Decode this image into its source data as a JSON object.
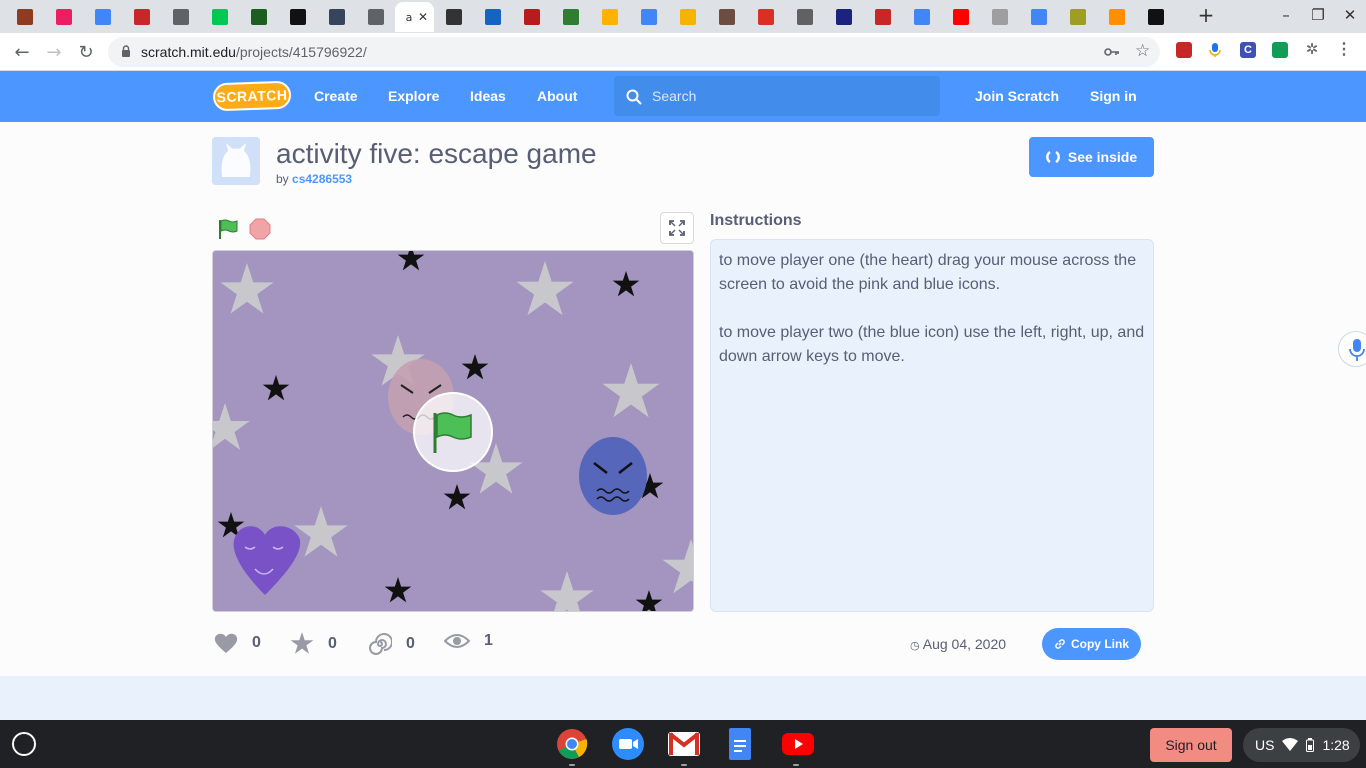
{
  "browser": {
    "tabs": [
      {
        "icon": "fire-icon",
        "color": "#8e3b20"
      },
      {
        "icon": "contact-card-icon",
        "color": "#e91e63"
      },
      {
        "icon": "docs-icon",
        "color": "#4285f4"
      },
      {
        "icon": "pelican-icon",
        "color": "#c62828"
      },
      {
        "icon": "classroom-doc-icon",
        "color": "#5f6368"
      },
      {
        "icon": "hexagon-icon",
        "color": "#00c853"
      },
      {
        "icon": "grid-app-icon",
        "color": "#1b5e20"
      },
      {
        "icon": "qr-grid-icon",
        "color": "#111111"
      },
      {
        "icon": "tumblr-icon",
        "color": "#35465c"
      },
      {
        "icon": "spiral-icon",
        "color": "#5f6368"
      },
      {
        "icon": "scratch-icon",
        "color": "#ffab19",
        "active": true
      },
      {
        "icon": "shield-icon",
        "color": "#333333"
      },
      {
        "icon": "bracket-k-icon",
        "color": "#1565c0"
      },
      {
        "icon": "wa-icon",
        "color": "#b71c1c"
      },
      {
        "icon": "green-book-icon",
        "color": "#2e7d32"
      },
      {
        "icon": "yellow-circle-icon",
        "color": "#ffb300"
      },
      {
        "icon": "google-icon",
        "color": "#4285f4"
      },
      {
        "icon": "slides-icon",
        "color": "#f4b400"
      },
      {
        "icon": "calendar-card-icon",
        "color": "#6d4c41"
      },
      {
        "icon": "gmail-icon",
        "color": "#d93025"
      },
      {
        "icon": "globe-icon",
        "color": "#616161"
      },
      {
        "icon": "round-logo-icon",
        "color": "#1a237e"
      },
      {
        "icon": "flag-logo-icon",
        "color": "#c62828"
      },
      {
        "icon": "google-icon",
        "color": "#4285f4"
      },
      {
        "icon": "youtube-icon",
        "color": "#ff0000"
      },
      {
        "icon": "f-logo-icon",
        "color": "#9e9e9e"
      },
      {
        "icon": "docs-icon",
        "color": "#4285f4"
      },
      {
        "icon": "pear-icon",
        "color": "#9e9d24"
      },
      {
        "icon": "cartoon-face-icon",
        "color": "#ff8f00"
      },
      {
        "icon": "k-logo-icon",
        "color": "#111111"
      }
    ],
    "active_tab_label": "a",
    "url_host": "scratch.mit.edu",
    "url_path": "/projects/415796922/"
  },
  "scratch_nav": {
    "logo": "SCRATCH",
    "links": [
      "Create",
      "Explore",
      "Ideas",
      "About"
    ],
    "search_placeholder": "Search",
    "join": "Join Scratch",
    "sign_in": "Sign in"
  },
  "project": {
    "title": "activity five: escape game",
    "by_prefix": "by",
    "author": "cs4286553",
    "see_inside": "See inside",
    "instructions_heading": "Instructions",
    "instructions": [
      "to move player one (the heart) drag your mouse across the screen to avoid the pink and blue icons.",
      "to move player two (the blue icon) use the left, right, up, and down arrow keys to move."
    ],
    "stats": {
      "loves": "0",
      "favorites": "0",
      "remixes": "0",
      "views": "1"
    },
    "shared_date": "Aug 04, 2020",
    "copy_link": "Copy Link"
  },
  "shelf": {
    "sign_out": "Sign out",
    "locale": "US",
    "time": "1:28",
    "apps": [
      "chrome-icon",
      "zoom-icon",
      "gmail-icon",
      "docs-icon",
      "youtube-icon"
    ]
  },
  "colors": {
    "scratch_blue": "#4c97ff",
    "stage_bg": "#a395c0",
    "instructions_bg": "#e9f1fc",
    "sign_out": "#f28b82"
  }
}
